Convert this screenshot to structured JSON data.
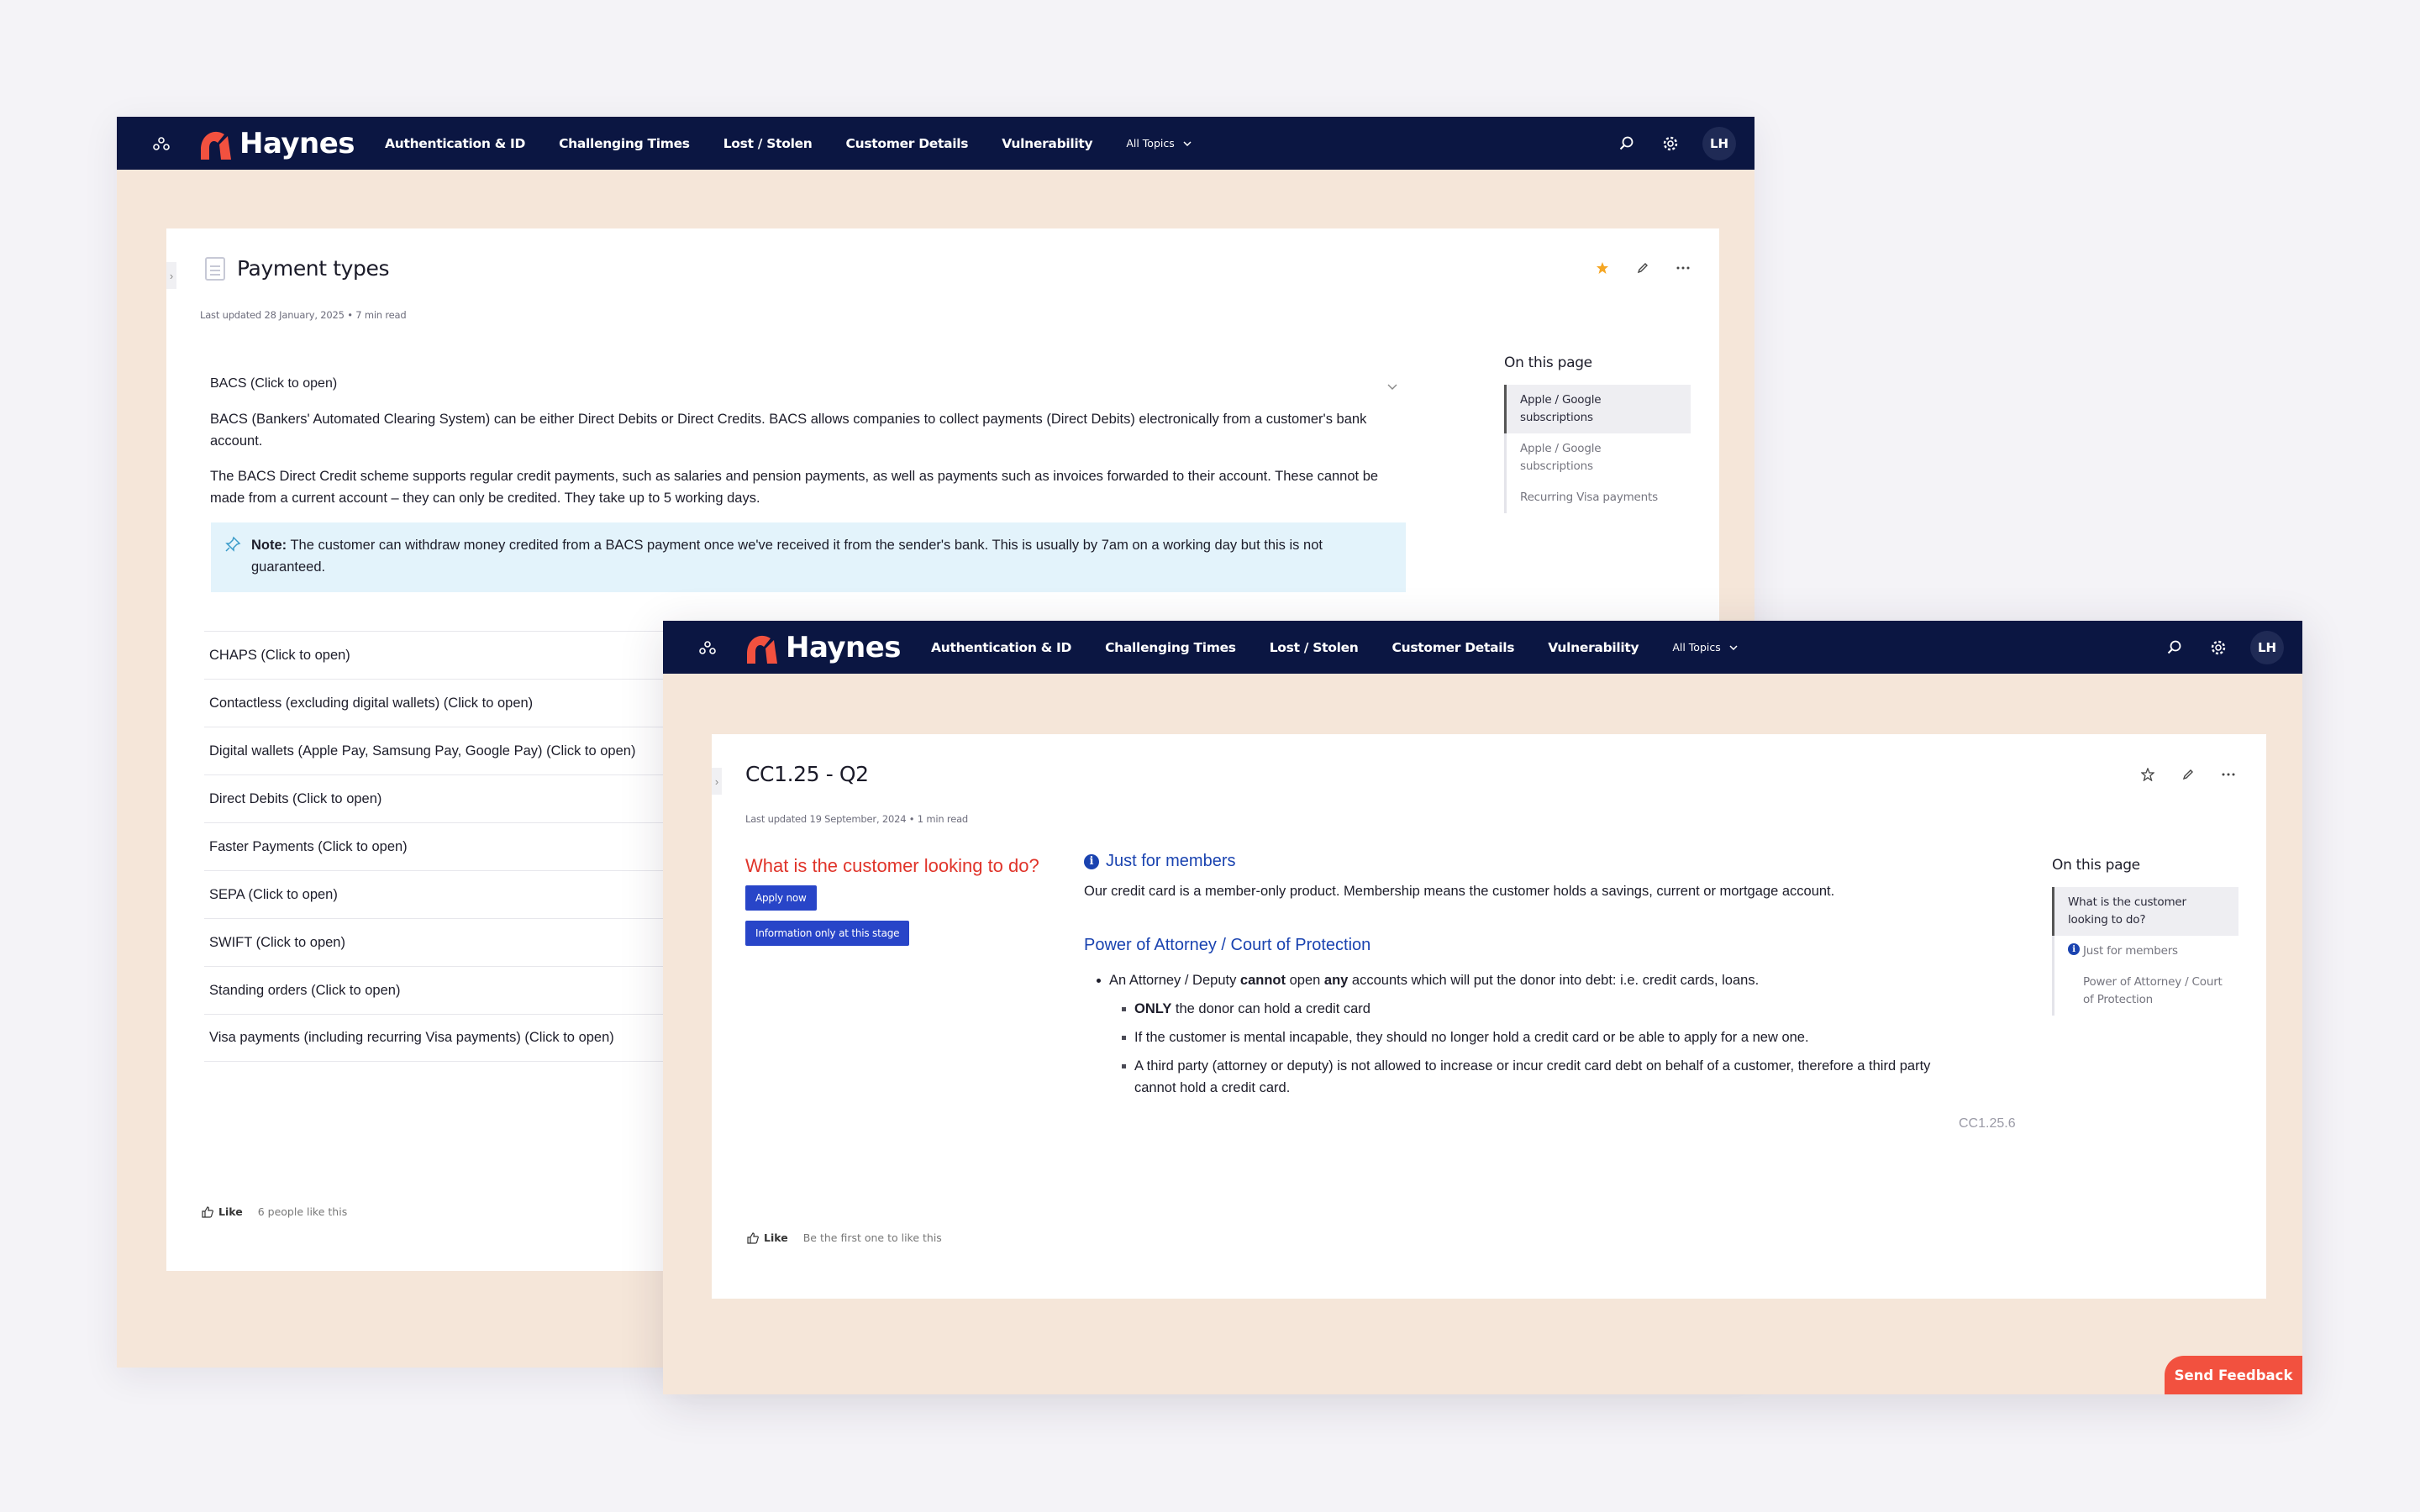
{
  "nav": {
    "brand": "Haynes",
    "links": [
      "Authentication & ID",
      "Challenging Times",
      "Lost / Stolen",
      "Customer Details",
      "Vulnerability"
    ],
    "all_topics": "All Topics",
    "avatar": "LH"
  },
  "back_page": {
    "title": "Payment types",
    "meta": "Last updated 28 January, 2025  •  7 min read",
    "open_section": {
      "heading": "BACS (Click to open)",
      "para1": "BACS (Bankers' Automated Clearing System) can be either Direct Debits or Direct Credits. BACS allows companies to collect payments (Direct Debits) electronically from a customer's bank account.",
      "para2": "The BACS Direct Credit scheme supports regular credit payments, such as salaries and pension payments, as well as payments such as invoices forwarded to their account. These cannot be made from a current account – they can only be credited. They take up to 5 working days.",
      "note_label": "Note:",
      "note_text": "The customer can withdraw money credited from a BACS payment once we've received it from the sender's bank. This is usually by 7am on a working day but this is not guaranteed."
    },
    "sections": [
      "CHAPS (Click to open)",
      "Contactless (excluding digital wallets) (Click to open)",
      "Digital wallets (Apple Pay, Samsung Pay, Google Pay) (Click to open)",
      "Direct Debits (Click to open)",
      "Faster Payments (Click to open)",
      "SEPA (Click to open)",
      "SWIFT (Click to open)",
      "Standing orders (Click to open)",
      "Visa payments (including recurring Visa payments) (Click to open)"
    ],
    "toc": {
      "title": "On this page",
      "items": [
        "Apple / Google subscriptions",
        "Apple / Google subscriptions",
        "Recurring Visa payments"
      ]
    },
    "like": {
      "label": "Like",
      "count": "6 people like this"
    }
  },
  "front_page": {
    "title": "CC1.25 - Q2",
    "meta": "Last updated 19 September, 2024  •  1 min read",
    "question": "What is the customer looking to do?",
    "btn_apply": "Apply now",
    "btn_info": "Information only at this stage",
    "members_heading": "Just for members",
    "members_text": "Our credit card is a member-only product. Membership means the customer holds a savings, current or mortgage account.",
    "poa_heading": "Power of Attorney / Court of Protection",
    "bullet1_pre": "An Attorney / Deputy ",
    "bullet1_b1": "cannot",
    "bullet1_mid": " open ",
    "bullet1_b2": "any",
    "bullet1_post": " accounts which will put the donor into debt: i.e. credit cards, loans.",
    "sub1_bold": "ONLY",
    "sub1_rest": " the donor can hold a credit card",
    "sub2": "If the customer is mental incapable, they should no longer hold a credit card or be able to apply for a new one.",
    "sub3": "A third party (attorney or deputy) is not allowed to increase or incur credit card debt on behalf of a customer, therefore a third party cannot hold a credit card.",
    "ref": "CC1.25.6",
    "toc": {
      "title": "On this page",
      "items": [
        "What is the customer looking to do?",
        "Just for members",
        "Power of Attorney / Court of Protection"
      ]
    },
    "like": {
      "label": "Like",
      "count": "Be the first one to like this"
    },
    "feedback": "Send Feedback"
  },
  "colors": {
    "navbar": "#0b1642",
    "brand_red": "#f2513f",
    "accent_blue": "#2845c8",
    "star": "#f5a623"
  }
}
